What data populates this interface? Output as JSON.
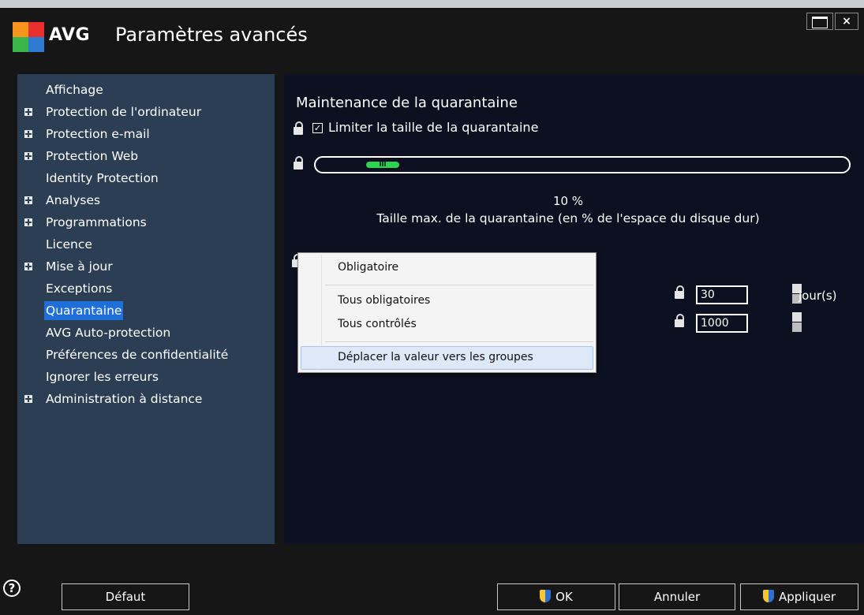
{
  "window": {
    "brand": "AVG",
    "title": "Paramètres avancés",
    "maximize_label": "",
    "close_label": "×"
  },
  "sidebar": {
    "items": [
      {
        "label": "Affichage",
        "expandable": false,
        "selected": false
      },
      {
        "label": "Protection de l'ordinateur",
        "expandable": true,
        "selected": false
      },
      {
        "label": "Protection e-mail",
        "expandable": true,
        "selected": false
      },
      {
        "label": "Protection Web",
        "expandable": true,
        "selected": false
      },
      {
        "label": "Identity Protection",
        "expandable": false,
        "selected": false
      },
      {
        "label": "Analyses",
        "expandable": true,
        "selected": false
      },
      {
        "label": "Programmations",
        "expandable": true,
        "selected": false
      },
      {
        "label": "Licence",
        "expandable": false,
        "selected": false
      },
      {
        "label": "Mise à jour",
        "expandable": true,
        "selected": false
      },
      {
        "label": "Exceptions",
        "expandable": false,
        "selected": false
      },
      {
        "label": "Quarantaine",
        "expandable": false,
        "selected": true
      },
      {
        "label": "AVG Auto-protection",
        "expandable": false,
        "selected": false
      },
      {
        "label": "Préférences de confidentialité",
        "expandable": false,
        "selected": false
      },
      {
        "label": "Ignorer les erreurs",
        "expandable": false,
        "selected": false
      },
      {
        "label": "Administration à distance",
        "expandable": true,
        "selected": false
      }
    ]
  },
  "main": {
    "section_title": "Maintenance de la quarantaine",
    "limit_checkbox": {
      "label": "Limiter la taille de la quarantaine",
      "checked": true,
      "mark": "✓"
    },
    "slider": {
      "value_percent": 10,
      "value_label": "10 %",
      "thumb_grip": "III",
      "description": "Taille max. de la quarantaine (en % de l'espace du disque dur)"
    },
    "days_field": {
      "value": "30",
      "unit": "jour(s)"
    },
    "count_field": {
      "value": "1000"
    }
  },
  "context_menu": {
    "items": [
      {
        "label": "Obligatoire"
      },
      {
        "label": "Tous obligatoires"
      },
      {
        "label": "Tous contrôlés"
      },
      {
        "label": "Déplacer la valeur vers les groupes",
        "highlighted": true
      }
    ]
  },
  "footer": {
    "help_label": "?",
    "default_label": "Défaut",
    "ok_label": "OK",
    "cancel_label": "Annuler",
    "apply_label": "Appliquer"
  },
  "colors": {
    "window_bg": "#161616",
    "sidebar_bg": "#2c3e53",
    "panel_bg": "#0c1020",
    "selection": "#1e6fd9",
    "slider_thumb": "#2bd54f"
  }
}
